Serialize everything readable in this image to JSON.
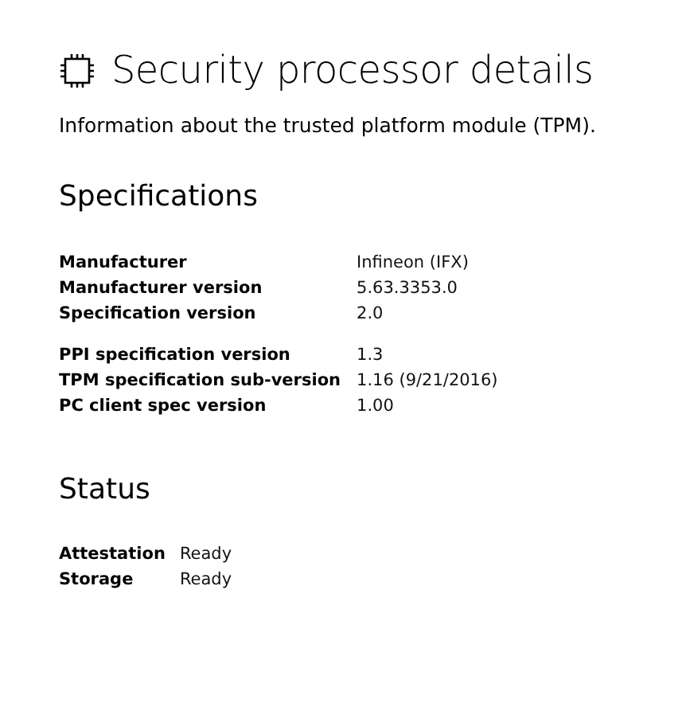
{
  "header": {
    "title": "Security processor details",
    "subtitle": "Information about the trusted platform module (TPM)."
  },
  "specifications": {
    "heading": "Specifications",
    "groups": [
      [
        {
          "label": "Manufacturer",
          "value": "Infineon (IFX)"
        },
        {
          "label": "Manufacturer version",
          "value": "5.63.3353.0"
        },
        {
          "label": "Specification version",
          "value": "2.0"
        }
      ],
      [
        {
          "label": "PPI specification version",
          "value": "1.3"
        },
        {
          "label": "TPM specification sub-version",
          "value": "1.16 (9/21/2016)"
        },
        {
          "label": "PC client spec version",
          "value": "1.00"
        }
      ]
    ]
  },
  "status": {
    "heading": "Status",
    "rows": [
      {
        "label": "Attestation",
        "value": "Ready"
      },
      {
        "label": "Storage",
        "value": "Ready"
      }
    ]
  }
}
